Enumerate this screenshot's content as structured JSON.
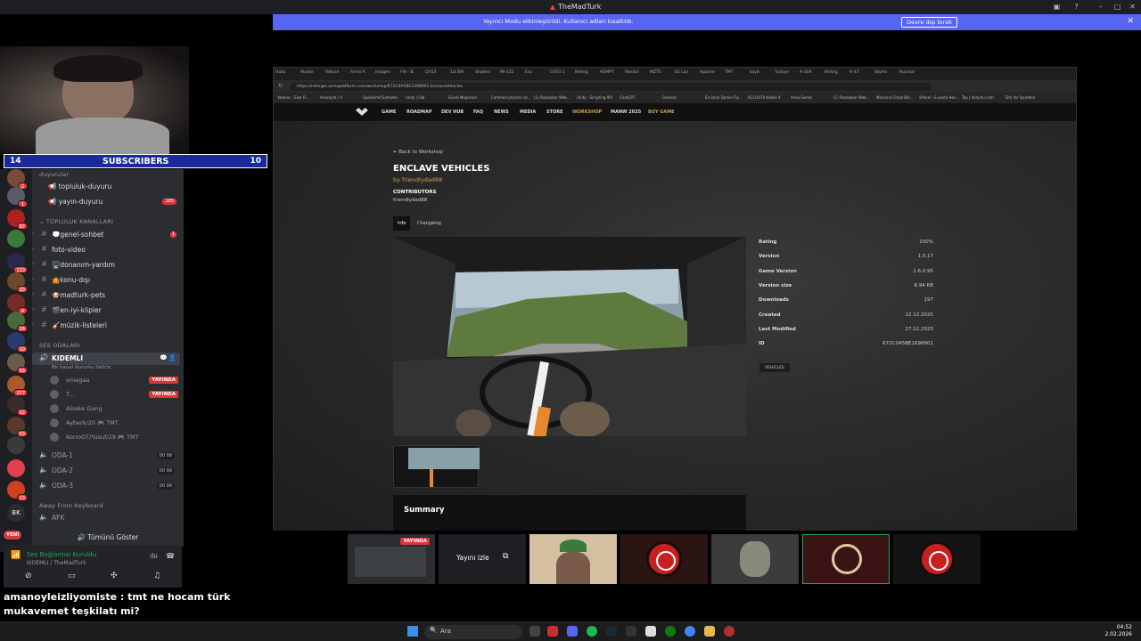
{
  "window": {
    "title": "TheMadTurk"
  },
  "banner": {
    "message": "Yayıncı Modu etkinleştirildi. Kullanıcı adları kısaltıldı.",
    "button": "Devre dışı bırak"
  },
  "subscribers": {
    "left": "14",
    "label": "SUBSCRIBERS",
    "right": "10"
  },
  "servers": [
    {
      "badge": "2",
      "color": "#7a4a3a"
    },
    {
      "badge": "1",
      "color": "#5a5a6a"
    },
    {
      "badge": "87",
      "color": "#b02020"
    },
    {
      "badge": "",
      "color": "#3a7a3a"
    },
    {
      "badge": "113",
      "color": "#2a2a4a"
    },
    {
      "badge": "20",
      "color": "#6a4a2a"
    },
    {
      "badge": "4",
      "color": "#7a2a2a"
    },
    {
      "badge": "26",
      "color": "#4a6a3a"
    },
    {
      "badge": "10",
      "color": "#2a3a6a"
    },
    {
      "badge": "56",
      "color": "#6a5a4a"
    },
    {
      "badge": "377",
      "color": "#aa5a2a"
    },
    {
      "badge": "32",
      "color": "#3a2a2a"
    },
    {
      "badge": "53",
      "color": "#5a3a2a"
    },
    {
      "badge": "",
      "color": "#3a3a3a"
    },
    {
      "badge": "",
      "color": "#e04050"
    },
    {
      "badge": "13",
      "color": "#d04020"
    }
  ],
  "server_bk": "BK",
  "server_new": "YENİ",
  "channels": {
    "cat_announce": "duyurular",
    "announce": [
      {
        "name": "📢 topluluk-duyuru",
        "count": ""
      },
      {
        "name": "📢 yayın-duyuru",
        "count": "185"
      }
    ],
    "cat_community": "TOPLULUK KANALLARI",
    "community": [
      {
        "name": "💭genel-sohbet",
        "count": "1"
      },
      {
        "name": "foto-video",
        "count": ""
      },
      {
        "name": "🖥️donanım-yardım",
        "count": ""
      },
      {
        "name": "🤷konu-dışı",
        "count": ""
      },
      {
        "name": "🐶madturk-pets",
        "count": ""
      },
      {
        "name": "🎬en-iyi-klipler",
        "count": ""
      },
      {
        "name": "🎸müzik-listeleri",
        "count": ""
      }
    ],
    "cat_voice": "SES ODALARI",
    "voice_main": "KIDEMLI",
    "voice_status": "Bir kanal durumu belirle",
    "users": [
      {
        "name": "omegaa",
        "live": "YAYINDA"
      },
      {
        "name": "T...",
        "live": "YAYINDA"
      },
      {
        "name": "Aloske Gang",
        "live": ""
      },
      {
        "name": "Ayberk/20 🎮 TMT",
        "live": ""
      },
      {
        "name": "KorroOT/Yusuf/29 🎮 TMT",
        "live": ""
      }
    ],
    "rooms": [
      {
        "name": "ODA-1",
        "count": "00 99"
      },
      {
        "name": "ODA-2",
        "count": "00 99"
      },
      {
        "name": "ODA-3",
        "count": "00 99"
      }
    ],
    "cat_afk": "Away From Keyboard",
    "afk": "AFK",
    "show_all": "Tümünü Göster"
  },
  "user_panel": {
    "connection": "Ses Bağlantısı Kuruldu",
    "sub": "KIDEMLI / TheMadTurk"
  },
  "chat": {
    "msg1_user": "amanoyleizliyomiste",
    "msg1_text": " : tmt ne hocam türk mukavemet teşkilatı mi?",
    "msg2_user": "amanoyleizliyomiste",
    "msg2_text": " : "
  },
  "browser": {
    "tabs": [
      "Hallo",
      "Aloske",
      "Refuse",
      "Arma R.",
      "Imagen",
      "FIA - B.",
      "CH53",
      "1st BN",
      "Shahed",
      "MI-151",
      "Enc",
      "CH53 1",
      "Reforg",
      "HEMPT",
      "Pandur",
      "MZTS",
      "81 Lan",
      "Apache",
      "TMT",
      "kayıt",
      "Turkiye",
      "A-10A",
      "Reforg",
      "H-47",
      "SkyHo",
      "Nuclear"
    ],
    "url": "https://reforger.armaplatform.com/workshop/672C0A5BE1698901-EnclaveVehicles",
    "bookmarks": [
      "Yabancı - Eser R...",
      "Anasayfa / X",
      "Spokslimit Extreme",
      "Unity | Fab",
      "Güvel Mopeciarı",
      "Common physics iss...",
      "(1) Rozolobar Web...",
      "Unity - Scripting API",
      "ChatGPT",
      "General",
      "En Uzun Domin Fly...",
      "ACCOUTA Kabile X",
      "Xnoo Genes",
      "(1) Rozolobar Web...",
      "Marcona Cirbal Bal...",
      "vPanel - E-posta Hes...",
      "Top | doluntu.com",
      "Tüm Yer İşaretleri"
    ],
    "nav": [
      "GAME",
      "ROADMAP",
      "DEV HUB",
      "FAQ",
      "NEWS",
      "MEDIA",
      "STORE",
      "WORKSHOP",
      "MANW 2025",
      "BUY GAME"
    ]
  },
  "workshop": {
    "back": "Back to Workshop",
    "title": "ENCLAVE VEHICLES",
    "by": "by friendlydad88",
    "contributors_label": "CONTRIBUTORS",
    "contributor": "friendlydad88",
    "tabs": [
      "Info",
      "Changelog"
    ],
    "stats": [
      {
        "k": "Rating",
        "v": "100%"
      },
      {
        "k": "Version",
        "v": "1.0.17"
      },
      {
        "k": "Game Version",
        "v": "1.6.0.95"
      },
      {
        "k": "Version size",
        "v": "6.94 KB"
      },
      {
        "k": "Downloads",
        "v": "197"
      },
      {
        "k": "Created",
        "v": "22.12.2025"
      },
      {
        "k": "Last Modified",
        "v": "27.12.2025"
      },
      {
        "k": "ID",
        "v": "672C0A5BE1698901"
      }
    ],
    "tag": "VEHICLES",
    "summary": "Summary"
  },
  "tiles": {
    "live": "YAYINDA",
    "watch": "Yayını izle"
  },
  "taskbar": {
    "search": "Ara",
    "time": "04:52",
    "date": "2.02.2026"
  },
  "colors": {
    "blurple": "#5865f2",
    "live": "#da373c",
    "accent": "#c8a050"
  }
}
